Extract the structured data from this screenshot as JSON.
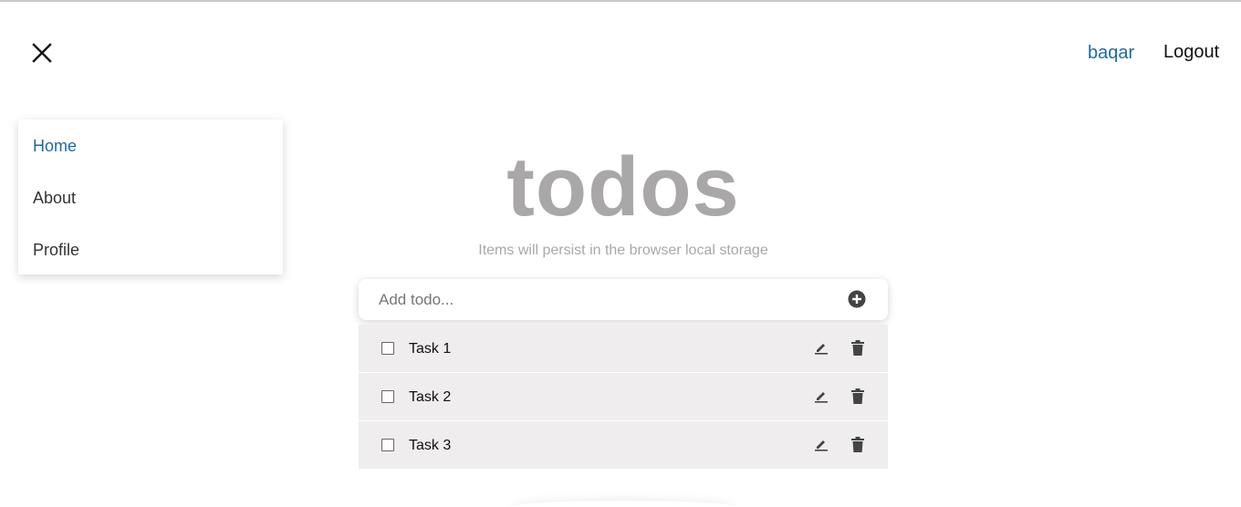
{
  "header": {
    "close_icon": "close-icon",
    "user_name": "baqar",
    "logout_label": "Logout"
  },
  "menu": {
    "items": [
      {
        "label": "Home",
        "active": true
      },
      {
        "label": "About",
        "active": false
      },
      {
        "label": "Profile",
        "active": false
      }
    ]
  },
  "main": {
    "title": "todos",
    "subtitle": "Items will persist in the browser local storage",
    "add_placeholder": "Add todo...",
    "add_icon": "plus-circle-icon",
    "todos": [
      {
        "text": "Task 1",
        "completed": false
      },
      {
        "text": "Task 2",
        "completed": false
      },
      {
        "text": "Task 3",
        "completed": false
      }
    ],
    "edit_icon": "pencil-icon",
    "delete_icon": "trash-icon"
  },
  "colors": {
    "accent": "#1e6aa3",
    "title": "#a9a7a7",
    "row_background": "#efeded",
    "icon": "#444444"
  }
}
